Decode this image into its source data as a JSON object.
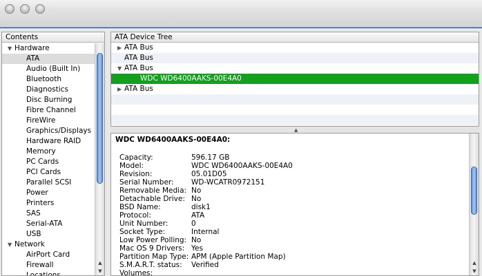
{
  "sidebar": {
    "header": "Contents",
    "rows": [
      {
        "type": "cat",
        "label": "Hardware",
        "tri": "▼"
      },
      {
        "type": "item",
        "label": "ATA",
        "selected": true
      },
      {
        "type": "item",
        "label": "Audio (Built In)"
      },
      {
        "type": "item",
        "label": "Bluetooth"
      },
      {
        "type": "item",
        "label": "Diagnostics"
      },
      {
        "type": "item",
        "label": "Disc Burning"
      },
      {
        "type": "item",
        "label": "Fibre Channel"
      },
      {
        "type": "item",
        "label": "FireWire"
      },
      {
        "type": "item",
        "label": "Graphics/Displays"
      },
      {
        "type": "item",
        "label": "Hardware RAID"
      },
      {
        "type": "item",
        "label": "Memory"
      },
      {
        "type": "item",
        "label": "PC Cards"
      },
      {
        "type": "item",
        "label": "PCI Cards"
      },
      {
        "type": "item",
        "label": "Parallel SCSI"
      },
      {
        "type": "item",
        "label": "Power"
      },
      {
        "type": "item",
        "label": "Printers"
      },
      {
        "type": "item",
        "label": "SAS"
      },
      {
        "type": "item",
        "label": "Serial-ATA"
      },
      {
        "type": "item",
        "label": "USB"
      },
      {
        "type": "cat",
        "label": "Network",
        "tri": "▼"
      },
      {
        "type": "item",
        "label": "AirPort Card"
      },
      {
        "type": "item",
        "label": "Firewall"
      },
      {
        "type": "item",
        "label": "Locations"
      }
    ]
  },
  "tree": {
    "header": "ATA Device Tree",
    "rows": [
      {
        "label": "ATA Bus",
        "tri": "▶",
        "indent": 1
      },
      {
        "label": "ATA Bus",
        "tri": "",
        "indent": 1
      },
      {
        "label": "ATA Bus",
        "tri": "▼",
        "indent": 1
      },
      {
        "label": "WDC WD6400AAKS-00E4A0",
        "tri": "",
        "indent": 2,
        "selected": true
      },
      {
        "label": "ATA Bus",
        "tri": "▶",
        "indent": 1
      },
      {
        "label": "",
        "tri": "",
        "indent": 1
      },
      {
        "label": "",
        "tri": "",
        "indent": 1
      },
      {
        "label": "",
        "tri": "",
        "indent": 1
      }
    ]
  },
  "detail": {
    "title": "WDC WD6400AAKS-00E4A0:",
    "fields": [
      {
        "key": "Capacity:",
        "value": "596.17 GB"
      },
      {
        "key": "Model:",
        "value": "WDC WD6400AAKS-00E4A0"
      },
      {
        "key": "Revision:",
        "value": "05.01D05"
      },
      {
        "key": "Serial Number:",
        "value": "WD-WCATR0972151"
      },
      {
        "key": "Removable Media:",
        "value": "No"
      },
      {
        "key": "Detachable Drive:",
        "value": "No"
      },
      {
        "key": "BSD Name:",
        "value": "disk1"
      },
      {
        "key": "Protocol:",
        "value": "ATA"
      },
      {
        "key": "Unit Number:",
        "value": "0"
      },
      {
        "key": "Socket Type:",
        "value": "Internal"
      },
      {
        "key": "Low Power Polling:",
        "value": "No"
      },
      {
        "key": "Mac OS 9 Drivers:",
        "value": "Yes"
      },
      {
        "key": "Partition Map Type:",
        "value": "APM (Apple Partition Map)"
      },
      {
        "key": "S.M.A.R.T. status:",
        "value": "Verified"
      },
      {
        "key": "Volumes:",
        "value": ""
      }
    ]
  },
  "colors": {
    "selection": "#0fa21a",
    "desktop": "#1f3a8a"
  }
}
